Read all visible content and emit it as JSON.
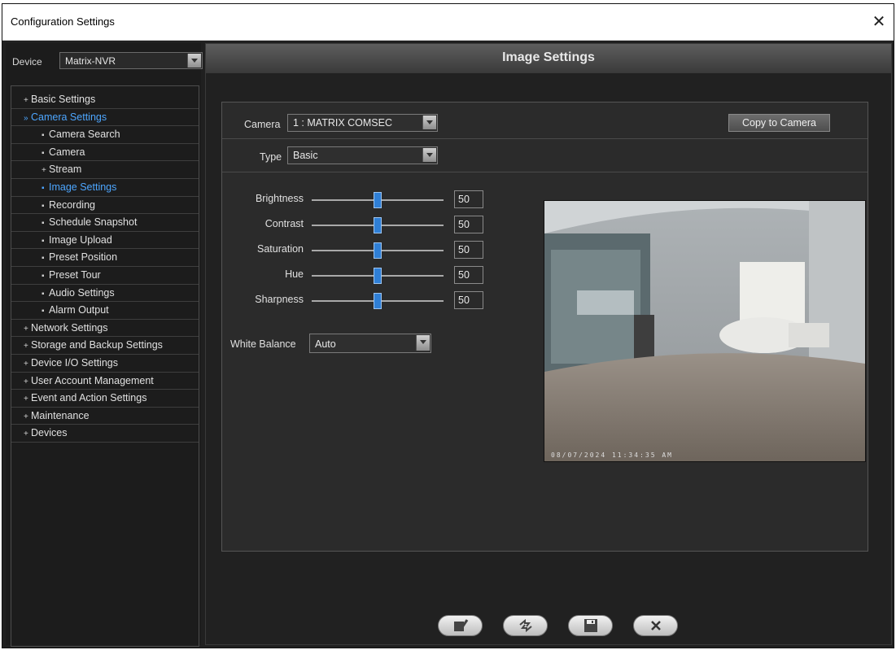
{
  "window": {
    "title": "Configuration Settings",
    "close_glyph": "✕"
  },
  "device": {
    "label": "Device",
    "value": "Matrix-NVR"
  },
  "tree": [
    {
      "label": "Basic Settings",
      "level": 0,
      "marker": "+"
    },
    {
      "label": "Camera Settings",
      "level": 0,
      "marker": "»",
      "active": true
    },
    {
      "label": "Camera Search",
      "level": 1,
      "marker": "▪"
    },
    {
      "label": "Camera",
      "level": 1,
      "marker": "▪"
    },
    {
      "label": "Stream",
      "level": 1,
      "marker": "+"
    },
    {
      "label": "Image Settings",
      "level": 1,
      "marker": "▪",
      "active": true
    },
    {
      "label": "Recording",
      "level": 1,
      "marker": "▪"
    },
    {
      "label": "Schedule Snapshot",
      "level": 1,
      "marker": "▪"
    },
    {
      "label": "Image Upload",
      "level": 1,
      "marker": "▪"
    },
    {
      "label": "Preset Position",
      "level": 1,
      "marker": "▪"
    },
    {
      "label": "Preset Tour",
      "level": 1,
      "marker": "▪"
    },
    {
      "label": "Audio Settings",
      "level": 1,
      "marker": "▪"
    },
    {
      "label": "Alarm Output",
      "level": 1,
      "marker": "▪"
    },
    {
      "label": "Network Settings",
      "level": 0,
      "marker": "+"
    },
    {
      "label": "Storage and Backup Settings",
      "level": 0,
      "marker": "+"
    },
    {
      "label": "Device I/O Settings",
      "level": 0,
      "marker": "+"
    },
    {
      "label": "User Account Management",
      "level": 0,
      "marker": "+"
    },
    {
      "label": "Event and Action Settings",
      "level": 0,
      "marker": "+"
    },
    {
      "label": "Maintenance",
      "level": 0,
      "marker": "+"
    },
    {
      "label": "Devices",
      "level": 0,
      "marker": "+"
    }
  ],
  "main": {
    "title": "Image Settings",
    "camera_label": "Camera",
    "camera_value": "1 : MATRIX COMSEC",
    "copy_button": "Copy to Camera",
    "type_label": "Type",
    "type_value": "Basic",
    "sliders": [
      {
        "label": "Brightness",
        "value": "50",
        "fraction": 0.5
      },
      {
        "label": "Contrast",
        "value": "50",
        "fraction": 0.5
      },
      {
        "label": "Saturation",
        "value": "50",
        "fraction": 0.5
      },
      {
        "label": "Hue",
        "value": "50",
        "fraction": 0.5
      },
      {
        "label": "Sharpness",
        "value": "50",
        "fraction": 0.5
      }
    ],
    "white_balance_label": "White Balance",
    "white_balance_value": "Auto",
    "preview_timestamp": "08/07/2024  11:34:35 AM"
  },
  "colors": {
    "accent": "#4da6ff",
    "slider_thumb": "#2f7fd6",
    "background": "#202020"
  },
  "bottom_buttons": [
    "apply-icon",
    "refresh-icon",
    "save-icon",
    "cancel-icon"
  ]
}
